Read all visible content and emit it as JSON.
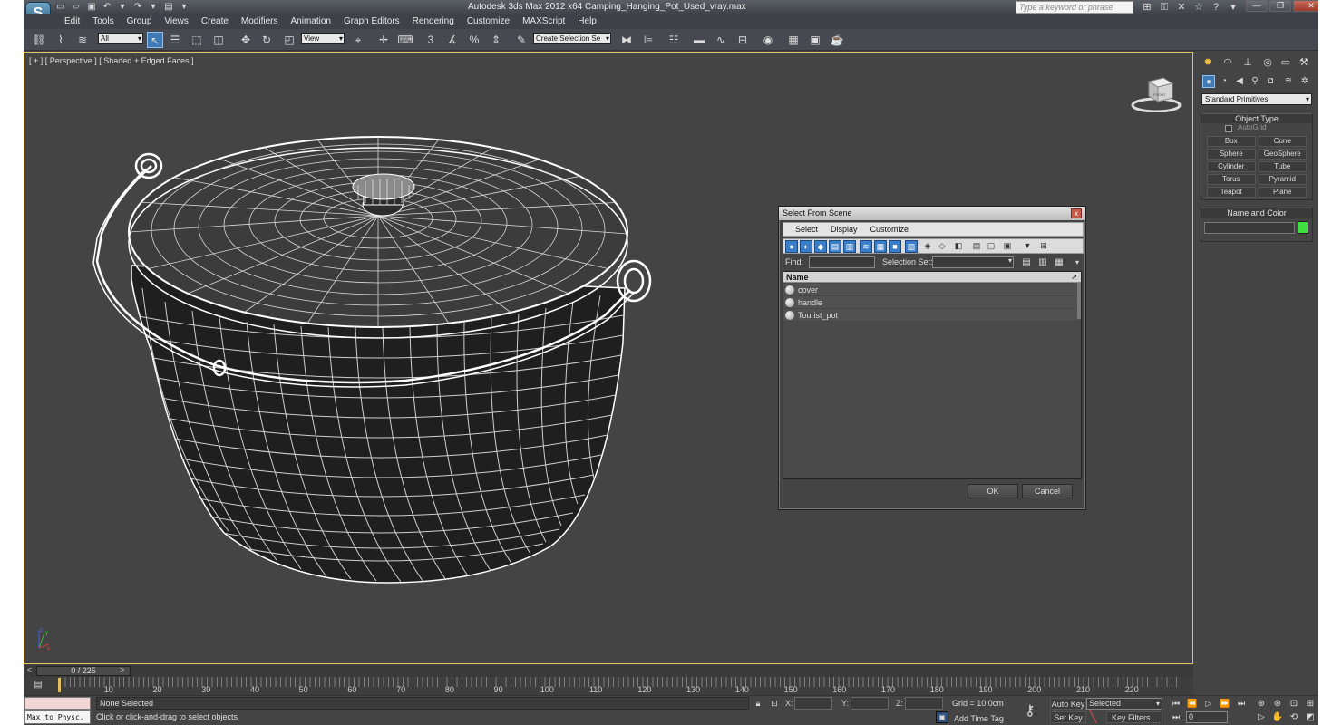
{
  "window": {
    "title": "Autodesk 3ds Max  2012 x64     Camping_Hanging_Pot_Used_vray.max",
    "search_placeholder": "Type a keyword or phrase"
  },
  "menu": [
    "Edit",
    "Tools",
    "Group",
    "Views",
    "Create",
    "Modifiers",
    "Animation",
    "Graph Editors",
    "Rendering",
    "Customize",
    "MAXScript",
    "Help"
  ],
  "toolbar": {
    "filter": "All",
    "ref_coord": "View",
    "snap_3": "3",
    "named_sel": "Create Selection Se"
  },
  "viewport": {
    "label": "[ + ] [ Perspective ] [ Shaded + Edged Faces ]",
    "viewcube_face": "FRONT"
  },
  "command_panel": {
    "category": "Standard Primitives",
    "object_type_title": "Object Type",
    "autogrid": "AutoGrid",
    "primitives": [
      "Box",
      "Cone",
      "Sphere",
      "GeoSphere",
      "Cylinder",
      "Tube",
      "Torus",
      "Pyramid",
      "Teapot",
      "Plane"
    ],
    "name_color_title": "Name and Color",
    "object_color": "#3fe040"
  },
  "dialog": {
    "title": "Select From Scene",
    "menu": [
      "Select",
      "Display",
      "Customize"
    ],
    "find_label": "Find:",
    "selection_set_label": "Selection Set:",
    "column_header": "Name",
    "items": [
      "cover",
      "handle",
      "Tourist_pot"
    ],
    "ok": "OK",
    "cancel": "Cancel",
    "close": "x"
  },
  "time_slider": {
    "position": "0 / 225",
    "left": "<",
    "right": ">"
  },
  "trackbar": {
    "ticks": [
      "10",
      "20",
      "30",
      "40",
      "50",
      "60",
      "70",
      "80",
      "90",
      "100",
      "110",
      "120",
      "130",
      "140",
      "150",
      "160",
      "170",
      "180",
      "190",
      "200",
      "210",
      "220"
    ]
  },
  "status": {
    "maxscript_text": "Max to Physc.",
    "selection": "None Selected",
    "prompt": "Click or click-and-drag to select objects",
    "x_label": "X:",
    "y_label": "Y:",
    "z_label": "Z:",
    "grid": "Grid = 10,0cm",
    "add_time_tag": "Add Time Tag",
    "auto_key": "Auto Key",
    "set_key": "Set Key",
    "key_mode": "Selected",
    "key_filters": "Key Filters...",
    "frame": "0"
  },
  "colors": {
    "accent": "#3e7ab5",
    "viewport_border": "#e6c15a",
    "wireframe": "#ffffff"
  }
}
